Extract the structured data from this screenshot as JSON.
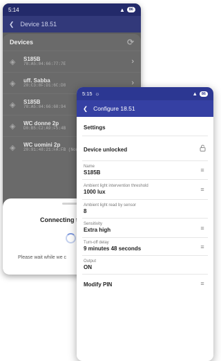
{
  "back_phone": {
    "status": {
      "time": "5:14",
      "battery": "86"
    },
    "appbar": {
      "title": "Device 18.51"
    },
    "devices_header": "Devices",
    "devices": [
      {
        "name": "S185B",
        "mac": "78:A5:04:66:77:7E"
      },
      {
        "name": "uff. Sabba",
        "mac": "20:C3:8F:D1:6C:D8"
      },
      {
        "name": "S185B",
        "mac": "78:A5:04:66:68:94"
      },
      {
        "name": "WC donne 2p",
        "mac": "D0:B5:C2:A9:F5:4B"
      },
      {
        "name": "WC uomini 2p",
        "mac": "20:91:48:21:FA:FB (Nor"
      }
    ],
    "dialog": {
      "title": "Connecting t",
      "message": "Please wait while we c"
    }
  },
  "front_phone": {
    "status": {
      "time": "5:15",
      "battery": "86"
    },
    "appbar": {
      "title": "Configure 18.51"
    },
    "settings_header": "Settings",
    "device_unlocked": "Device unlocked",
    "fields": {
      "name": {
        "label": "Name",
        "value": "S185B"
      },
      "threshold": {
        "label": "Ambient light intervention threshold",
        "value": "1000 lux"
      },
      "light_read": {
        "label": "Ambient light read by sensor",
        "value": "8"
      },
      "sensitivity": {
        "label": "Sensitivity",
        "value": "Extra high"
      },
      "turnoff": {
        "label": "Turn-off delay",
        "value": "9 minutes 48 seconds"
      },
      "output": {
        "label": "Output",
        "value": "ON"
      }
    },
    "modify_pin": "Modify PIN"
  },
  "colors": {
    "front_status_bar": "#2c3792",
    "front_app_bar": "#3540a3",
    "back_app_bar": "#32397a"
  },
  "icons": {
    "back_arrow": "arrow-left-icon",
    "refresh": "refresh-icon",
    "wifi": "wifi-icon",
    "chevron": "chevron-right-icon",
    "lock": "lock-icon",
    "edit": "sliders-icon"
  }
}
